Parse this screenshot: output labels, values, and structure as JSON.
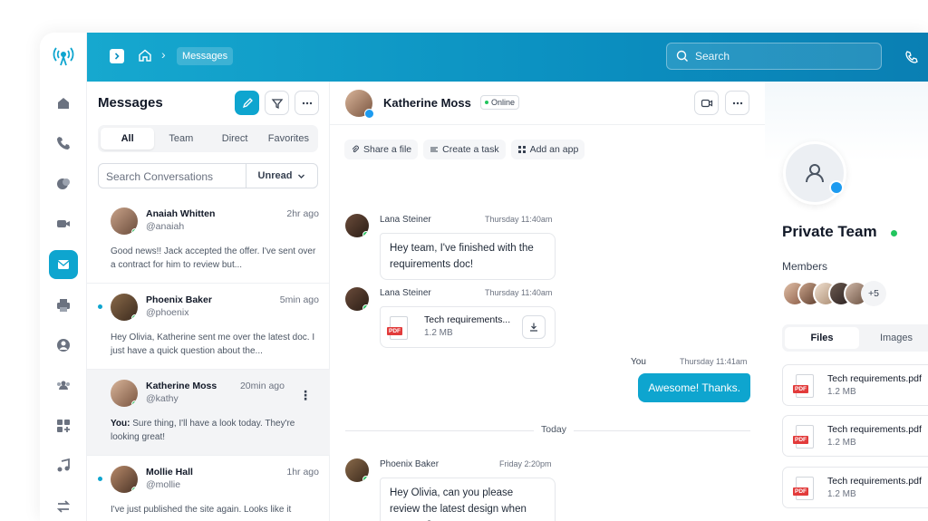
{
  "breadcrumb": {
    "current": "Messages"
  },
  "search": {
    "placeholder": "Search"
  },
  "conversations": {
    "title": "Messages",
    "tabs": [
      "All",
      "Team",
      "Direct",
      "Favorites"
    ],
    "search_placeholder": "Search Conversations",
    "filter_label": "Unread",
    "items": [
      {
        "name": "Anaiah Whitten",
        "handle": "@anaiah",
        "time": "2hr ago",
        "preview": "Good news!! Jack accepted the offer. I've sent over a contract for him to review but...",
        "unread": false
      },
      {
        "name": "Phoenix Baker",
        "handle": "@phoenix",
        "time": "5min ago",
        "preview": "Hey Olivia, Katherine sent me over the latest doc. I just have a quick question about the...",
        "unread": true
      },
      {
        "name": "Katherine Moss",
        "handle": "@kathy",
        "time": "20min ago",
        "preview_prefix": "You:",
        "preview": "Sure thing, I'll have a look today. They're looking great!",
        "unread": false
      },
      {
        "name": "Mollie Hall",
        "handle": "@mollie",
        "time": "1hr ago",
        "preview": "I've just published the site again. Looks like it",
        "unread": true
      }
    ]
  },
  "chat": {
    "name": "Katherine Moss",
    "status": "Online",
    "actions": [
      "Share a file",
      "Create a task",
      "Add an app"
    ],
    "messages": [
      {
        "sender": "Lana Steiner",
        "time": "Thursday 11:40am",
        "text": "Hey team, I've finished with the requirements doc!"
      },
      {
        "sender": "Lana Steiner",
        "time": "Thursday 11:40am",
        "file": {
          "name": "Tech requirements...",
          "size": "1.2 MB"
        }
      },
      {
        "sender": "You",
        "time": "Thursday 11:41am",
        "text": "Awesome! Thanks."
      },
      {
        "sender": "Phoenix Baker",
        "time": "Friday 2:20pm",
        "text": "Hey Olivia, can you please review the latest design when you can?"
      }
    ],
    "divider": "Today"
  },
  "details": {
    "title": "Private Team",
    "members_label": "Members",
    "more_members": "+5",
    "tabs": [
      "Files",
      "Images"
    ],
    "files": [
      {
        "name": "Tech requirements.pdf",
        "size": "1.2 MB"
      },
      {
        "name": "Tech requirements.pdf",
        "size": "1.2 MB"
      },
      {
        "name": "Tech requirements.pdf",
        "size": "1.2 MB"
      }
    ]
  },
  "colors": {
    "accent": "#0ea5cf",
    "online": "#22c55e",
    "pdf": "#e23b3b"
  }
}
